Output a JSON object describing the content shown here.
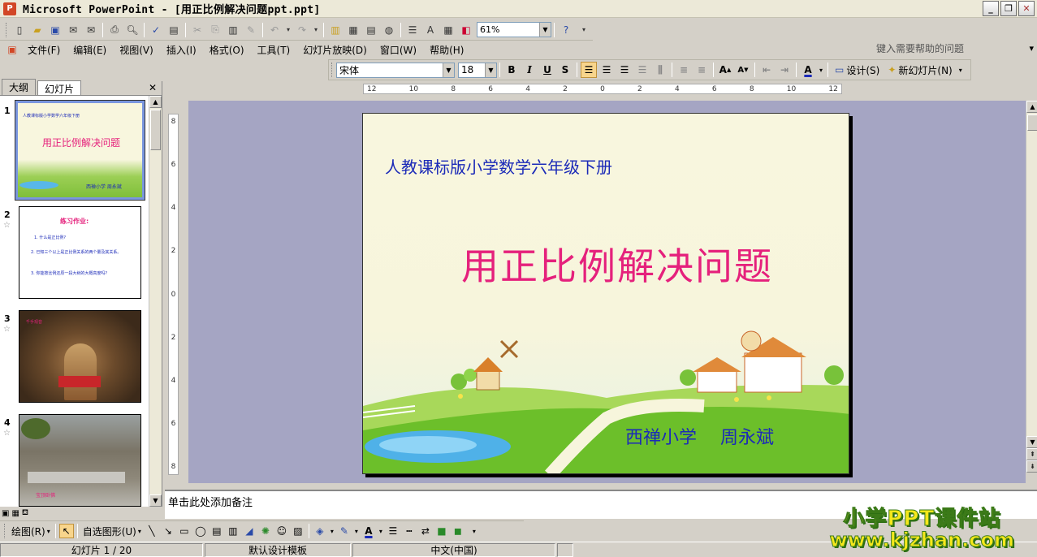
{
  "window": {
    "title": "Microsoft PowerPoint - [用正比例解决问题ppt.ppt]",
    "controls": [
      "_",
      "❐",
      "✕"
    ]
  },
  "toolbar_standard": {
    "zoom": "61%"
  },
  "menu": {
    "items": [
      "文件(F)",
      "编辑(E)",
      "视图(V)",
      "插入(I)",
      "格式(O)",
      "工具(T)",
      "幻灯片放映(D)",
      "窗口(W)",
      "帮助(H)"
    ],
    "help_placeholder": "键入需要帮助的问题"
  },
  "toolbar_formatting": {
    "font": "宋体",
    "size": "18",
    "design_label": "设计(S)",
    "new_slide_label": "新幻灯片(N)"
  },
  "left_pane": {
    "tabs": [
      "大纲",
      "幻灯片"
    ],
    "active_tab": 1,
    "slides": [
      {
        "number": "1",
        "subtitle": "人教课标版小学数学六年级下册",
        "title": "用正比例解决问题",
        "footer": "西禅小学  周永斌"
      },
      {
        "number": "2",
        "title": "练习作业:",
        "lines": [
          "1. 什么是正比例?",
          "2. 已知三个以上是正比例关系的两个量及其关系。",
          "3. 你能按比例还原一段大树的大概高度吗?"
        ]
      },
      {
        "number": "3",
        "caption": "千手观音"
      },
      {
        "number": "4",
        "caption": "宝顶卧佛"
      }
    ]
  },
  "rulers": {
    "horizontal": [
      "12",
      "10",
      "8",
      "6",
      "4",
      "2",
      "0",
      "2",
      "4",
      "6",
      "8",
      "10",
      "12"
    ],
    "vertical": [
      "8",
      "6",
      "4",
      "2",
      "0",
      "2",
      "4",
      "6",
      "8"
    ]
  },
  "slide": {
    "subtitle": "人教课标版小学数学六年级下册",
    "title": "用正比例解决问题",
    "author": "西禅小学　 周永斌"
  },
  "notes": {
    "placeholder": "单击此处添加备注"
  },
  "drawing_toolbar": {
    "draw_label": "绘图(R)",
    "autoshapes_label": "自选图形(U)"
  },
  "status": {
    "slide_info": "幻灯片 1 / 20",
    "template": "默认设计模板",
    "language": "中文(中国)"
  },
  "watermark": {
    "line1": "小学PPT课件站",
    "line2": "www.kjzhan.com"
  },
  "colors": {
    "slide_subtitle": "#1b2ab8",
    "slide_title": "#e5217c",
    "canvas_bg": "#a5a5c3"
  }
}
